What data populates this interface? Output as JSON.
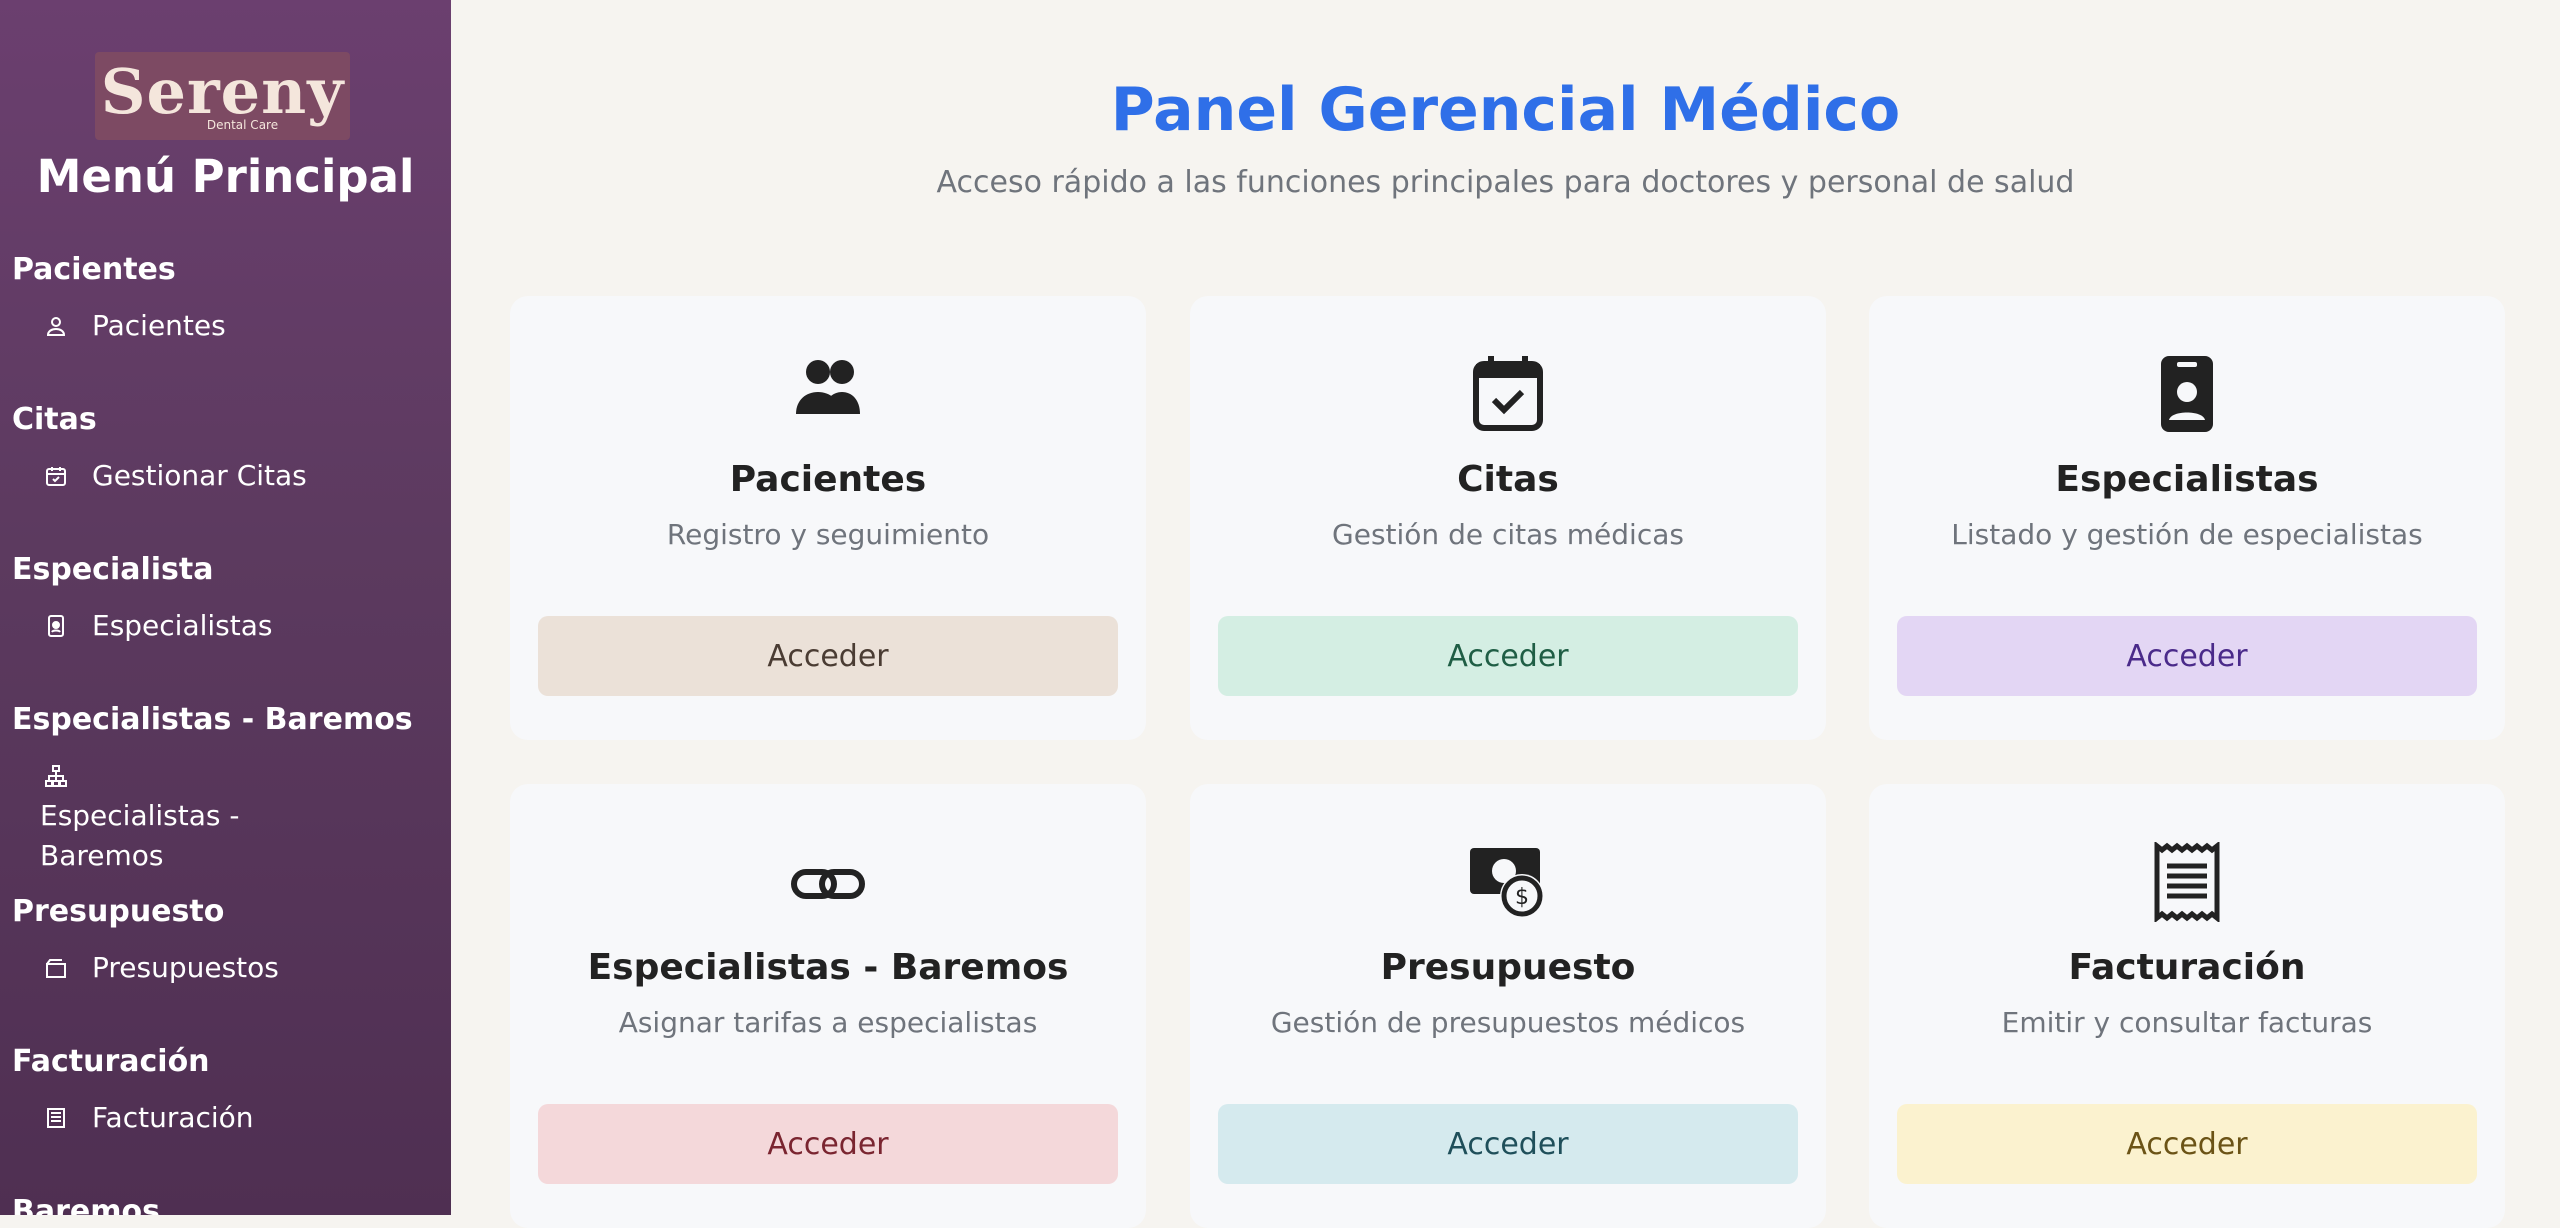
{
  "brand": {
    "logo_text": "Sereny",
    "logo_sub": "Dental Care"
  },
  "sidebar": {
    "title": "Menú Principal",
    "groups": [
      {
        "title": "Pacientes",
        "item": "Pacientes",
        "icon": "user-icon"
      },
      {
        "title": "Citas",
        "item": "Gestionar Citas",
        "icon": "calendar-check-icon"
      },
      {
        "title": "Especialista",
        "item": "Especialistas",
        "icon": "badge-icon"
      },
      {
        "title": "Especialistas - Baremos",
        "item": "Especialistas - Baremos",
        "icon": "sitemap-icon"
      },
      {
        "title": "Presupuesto",
        "item": "Presupuestos",
        "icon": "wallet-icon"
      },
      {
        "title": "Facturación",
        "item": "Facturación",
        "icon": "receipt-icon"
      },
      {
        "title": "Baremos",
        "item": "",
        "icon": ""
      }
    ]
  },
  "main": {
    "title": "Panel Gerencial Médico",
    "subtitle": "Acceso rápido a las funciones principales para doctores y personal de salud",
    "cards": [
      {
        "title": "Pacientes",
        "desc": "Registro y seguimiento",
        "button": "Acceder",
        "icon": "users-icon",
        "btn_bg": "#ebe1d8",
        "btn_fg": "#4a3c33"
      },
      {
        "title": "Citas",
        "desc": "Gestión de citas médicas",
        "button": "Acceder",
        "icon": "calendar-check-icon",
        "btn_bg": "#d4eee3",
        "btn_fg": "#1f5e45"
      },
      {
        "title": "Especialistas",
        "desc": "Listado y gestión de especialistas",
        "button": "Acceder",
        "icon": "id-badge-icon",
        "btn_bg": "#e3d6f4",
        "btn_fg": "#4a2a8a"
      },
      {
        "title": "Especialistas - Baremos",
        "desc": "Asignar tarifas a especialistas",
        "button": "Acceder",
        "icon": "link-icon",
        "btn_bg": "#f4d8da",
        "btn_fg": "#7a2530"
      },
      {
        "title": "Presupuesto",
        "desc": "Gestión de presupuestos médicos",
        "button": "Acceder",
        "icon": "money-icon",
        "btn_bg": "#d5eaee",
        "btn_fg": "#1f4f5a"
      },
      {
        "title": "Facturación",
        "desc": "Emitir y consultar facturas",
        "button": "Acceder",
        "icon": "receipt-icon",
        "btn_bg": "#fbf2cf",
        "btn_fg": "#6b5316"
      }
    ]
  }
}
